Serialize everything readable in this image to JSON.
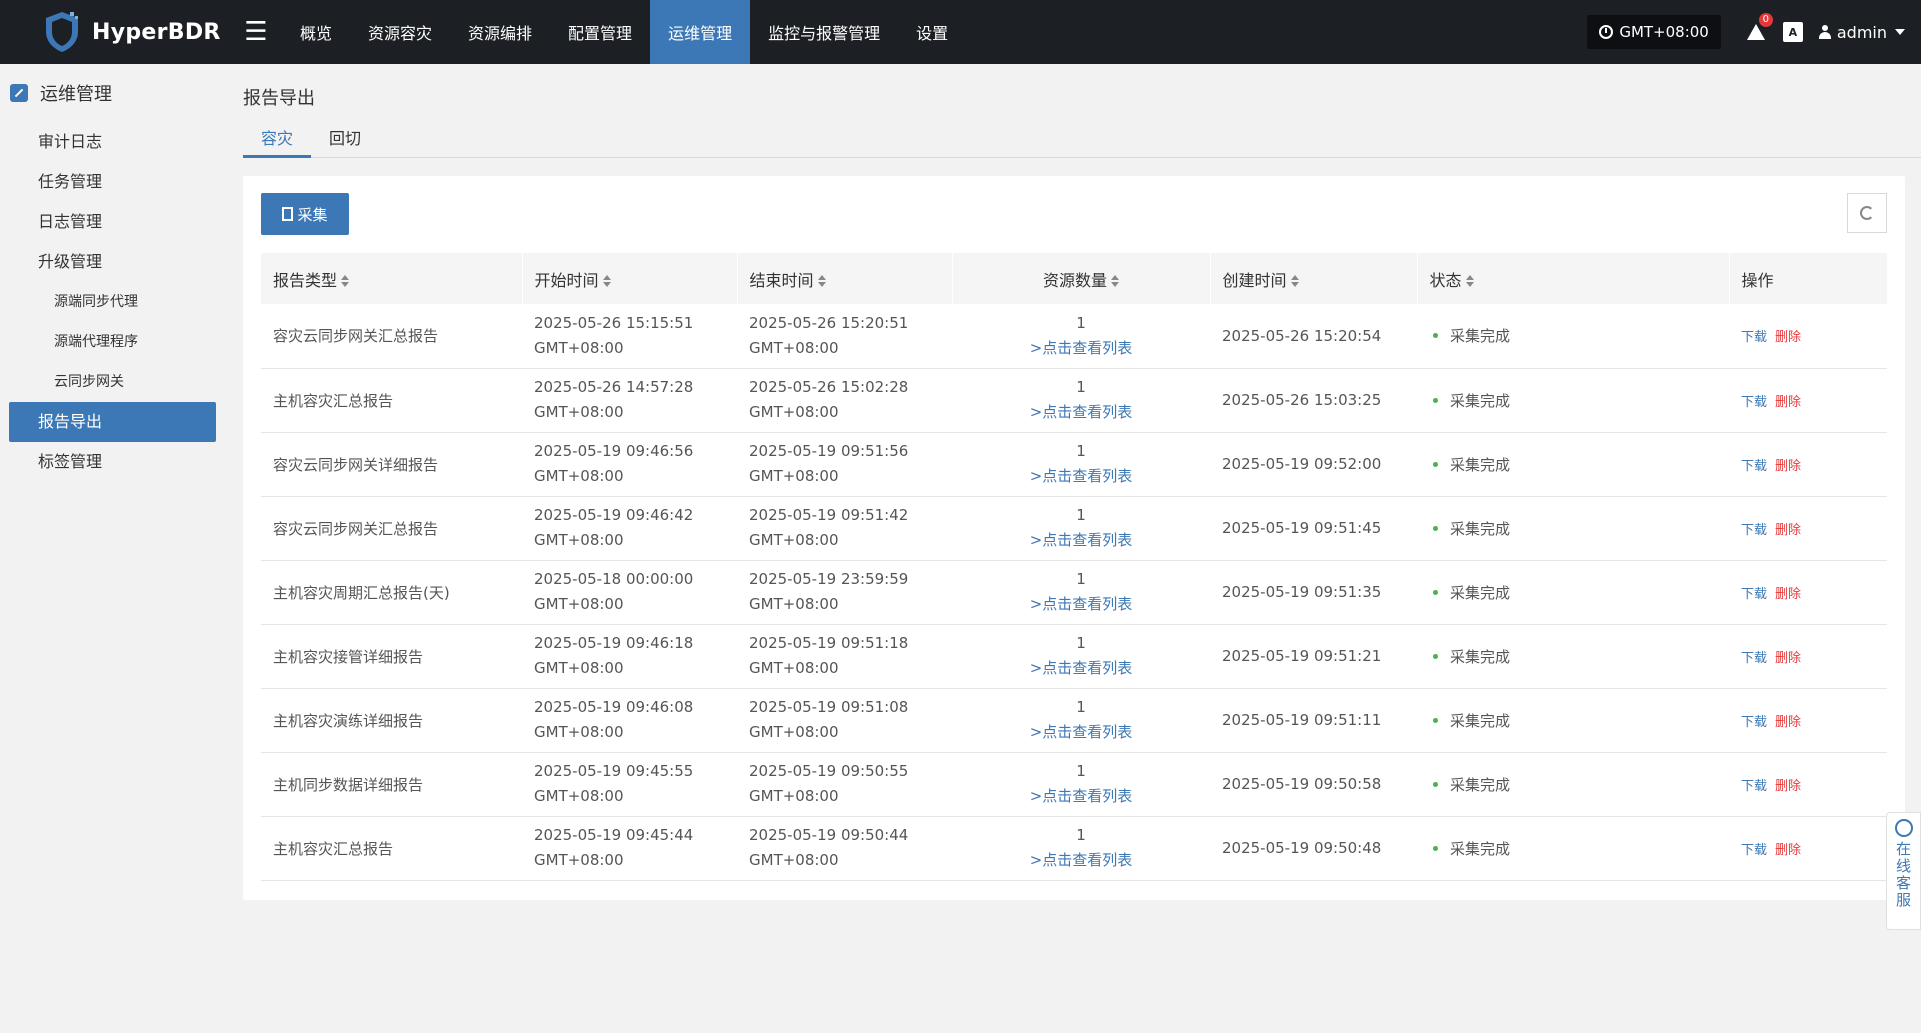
{
  "header": {
    "brand": "HyperBDR",
    "nav": [
      "概览",
      "资源容灾",
      "资源编排",
      "配置管理",
      "运维管理",
      "监控与报警管理",
      "设置"
    ],
    "active_nav_index": 4,
    "timezone": "GMT+08:00",
    "alert_count": "0",
    "lang_badge": "A",
    "user": "admin"
  },
  "sidebar": {
    "title": "运维管理",
    "items": [
      {
        "label": "审计日志"
      },
      {
        "label": "任务管理"
      },
      {
        "label": "日志管理"
      },
      {
        "label": "升级管理"
      },
      {
        "label": "源端同步代理"
      },
      {
        "label": "源端代理程序"
      },
      {
        "label": "云同步网关"
      },
      {
        "label": "报告导出"
      },
      {
        "label": "标签管理"
      }
    ]
  },
  "main": {
    "title": "报告导出",
    "tabs": [
      "容灾",
      "回切"
    ],
    "collect_button": "采集",
    "columns": [
      "报告类型",
      "开始时间",
      "结束时间",
      "资源数量",
      "创建时间",
      "状态",
      "操作"
    ],
    "view_list_link": ">点击查看列表",
    "download_label": "下载",
    "delete_label": "删除",
    "rows": [
      {
        "type": "容灾云同步网关汇总报告",
        "start": "2025-05-26 15:15:51",
        "start_tz": "GMT+08:00",
        "end": "2025-05-26 15:20:51",
        "end_tz": "GMT+08:00",
        "count": "1",
        "created": "2025-05-26 15:20:54",
        "status": "采集完成"
      },
      {
        "type": "主机容灾汇总报告",
        "start": "2025-05-26 14:57:28",
        "start_tz": "GMT+08:00",
        "end": "2025-05-26 15:02:28",
        "end_tz": "GMT+08:00",
        "count": "1",
        "created": "2025-05-26 15:03:25",
        "status": "采集完成"
      },
      {
        "type": "容灾云同步网关详细报告",
        "start": "2025-05-19 09:46:56",
        "start_tz": "GMT+08:00",
        "end": "2025-05-19 09:51:56",
        "end_tz": "GMT+08:00",
        "count": "1",
        "created": "2025-05-19 09:52:00",
        "status": "采集完成"
      },
      {
        "type": "容灾云同步网关汇总报告",
        "start": "2025-05-19 09:46:42",
        "start_tz": "GMT+08:00",
        "end": "2025-05-19 09:51:42",
        "end_tz": "GMT+08:00",
        "count": "1",
        "created": "2025-05-19 09:51:45",
        "status": "采集完成"
      },
      {
        "type": "主机容灾周期汇总报告(天)",
        "start": "2025-05-18 00:00:00",
        "start_tz": "GMT+08:00",
        "end": "2025-05-19 23:59:59",
        "end_tz": "GMT+08:00",
        "count": "1",
        "created": "2025-05-19 09:51:35",
        "status": "采集完成"
      },
      {
        "type": "主机容灾接管详细报告",
        "start": "2025-05-19 09:46:18",
        "start_tz": "GMT+08:00",
        "end": "2025-05-19 09:51:18",
        "end_tz": "GMT+08:00",
        "count": "1",
        "created": "2025-05-19 09:51:21",
        "status": "采集完成"
      },
      {
        "type": "主机容灾演练详细报告",
        "start": "2025-05-19 09:46:08",
        "start_tz": "GMT+08:00",
        "end": "2025-05-19 09:51:08",
        "end_tz": "GMT+08:00",
        "count": "1",
        "created": "2025-05-19 09:51:11",
        "status": "采集完成"
      },
      {
        "type": "主机同步数据详细报告",
        "start": "2025-05-19 09:45:55",
        "start_tz": "GMT+08:00",
        "end": "2025-05-19 09:50:55",
        "end_tz": "GMT+08:00",
        "count": "1",
        "created": "2025-05-19 09:50:58",
        "status": "采集完成"
      },
      {
        "type": "主机容灾汇总报告",
        "start": "2025-05-19 09:45:44",
        "start_tz": "GMT+08:00",
        "end": "2025-05-19 09:50:44",
        "end_tz": "GMT+08:00",
        "count": "1",
        "created": "2025-05-19 09:50:48",
        "status": "采集完成"
      }
    ]
  },
  "service": {
    "label": [
      "在",
      "线",
      "客",
      "服"
    ]
  },
  "colors": {
    "accent": "#3b78b5",
    "topbar": "#1c1f24",
    "success": "#4caf50",
    "danger": "#e5383b"
  }
}
